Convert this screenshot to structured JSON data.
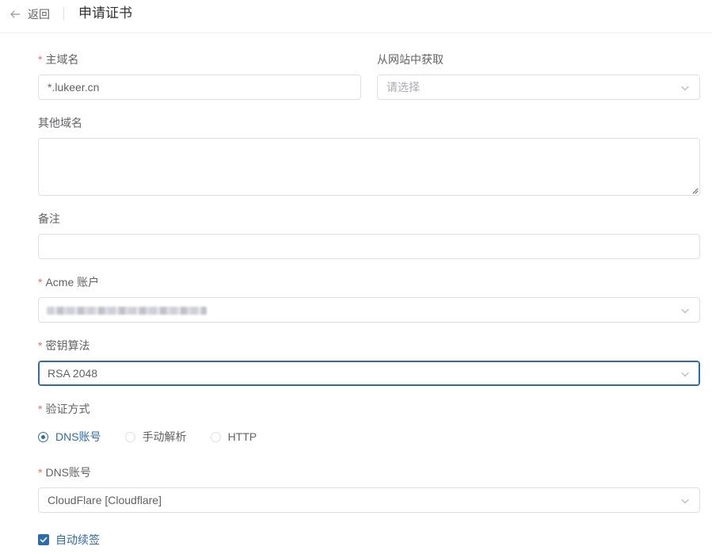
{
  "header": {
    "back_label": "返回",
    "title": "申请证书"
  },
  "form": {
    "required_mark": "*",
    "main_domain": {
      "label": "主域名",
      "value": "*.lukeer.cn"
    },
    "from_site": {
      "label": "从网站中获取",
      "placeholder": "请选择"
    },
    "other_domains": {
      "label": "其他域名",
      "value": ""
    },
    "remark": {
      "label": "备注",
      "value": ""
    },
    "acme_account": {
      "label": "Acme 账户"
    },
    "key_algorithm": {
      "label": "密钥算法",
      "value": "RSA 2048"
    },
    "verify_method": {
      "label": "验证方式",
      "options": [
        {
          "label": "DNS账号",
          "checked": true
        },
        {
          "label": "手动解析",
          "checked": false
        },
        {
          "label": "HTTP",
          "checked": false
        }
      ]
    },
    "dns_account": {
      "label": "DNS账号",
      "value": "CloudFlare [Cloudflare]"
    },
    "auto_renew": {
      "label": "自动续签",
      "checked": true
    }
  },
  "colors": {
    "primary": "#2b6cb0",
    "required": "#f56c6c",
    "border": "#dcdfe6"
  },
  "icons": {
    "back": "arrow-left-icon",
    "select": "chevron-down-icon",
    "check": "check-icon"
  }
}
